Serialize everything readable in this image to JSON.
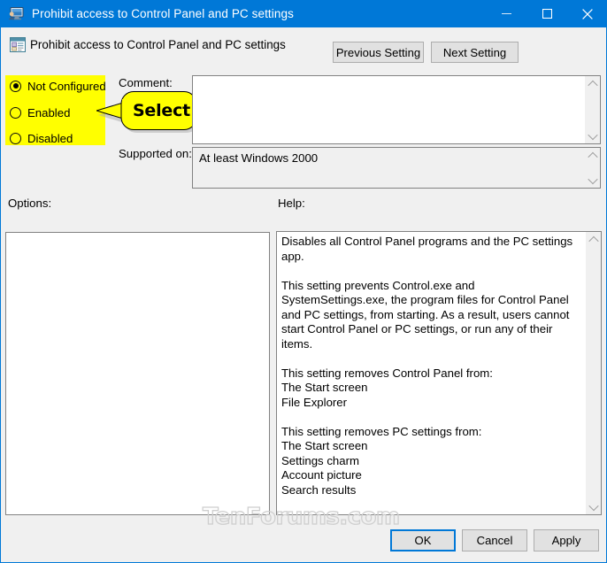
{
  "window": {
    "title": "Prohibit access to Control Panel and PC settings",
    "title_icon": "computer-monitor-icon",
    "minimize_glyph": "—",
    "maximize_glyph": "☐",
    "close_glyph": "✕",
    "titlebar_color": "#0078d7",
    "border_color": "#0078d7",
    "background_color": "#f0f0f0"
  },
  "header": {
    "icon": "group-policy-setting-icon",
    "title": "Prohibit access to Control Panel and PC settings",
    "previous_button": "Previous Setting",
    "next_button": "Next Setting"
  },
  "state_group": {
    "highlight_color": "#ffff00",
    "selected": "Not Configured",
    "options": [
      {
        "label": "Not Configured",
        "checked": true
      },
      {
        "label": "Enabled",
        "checked": false
      },
      {
        "label": "Disabled",
        "checked": false
      }
    ]
  },
  "callout": {
    "text": "Select",
    "fill_color": "#ffff00",
    "points_at": "Enabled"
  },
  "comment": {
    "label": "Comment:",
    "value": "",
    "placeholder": ""
  },
  "supported_on": {
    "label": "Supported on:",
    "value": "At least Windows 2000"
  },
  "options_panel": {
    "label": "Options:",
    "content": ""
  },
  "help_panel": {
    "label": "Help:",
    "text": "Disables all Control Panel programs and the PC settings app.\n\nThis setting prevents Control.exe and SystemSettings.exe, the program files for Control Panel and PC settings, from starting. As a result, users cannot start Control Panel or PC settings, or run any of their items.\n\nThis setting removes Control Panel from:\nThe Start screen\nFile Explorer\n\nThis setting removes PC settings from:\nThe Start screen\nSettings charm\nAccount picture\nSearch results\n\nIf users try to select a Control Panel item from the Properties item on a context menu, a message appears explaining that a setting prevents the action."
  },
  "footer": {
    "ok": "OK",
    "cancel": "Cancel",
    "apply": "Apply",
    "focus_color": "#0078d7"
  },
  "watermark": {
    "text": "TenForums.com"
  }
}
